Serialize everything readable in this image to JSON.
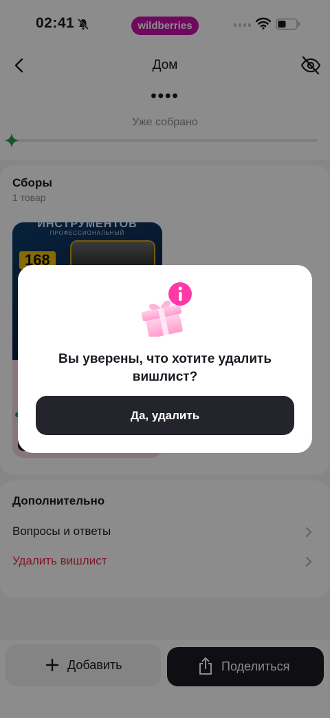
{
  "status_bar": {
    "time": "02:41",
    "brand": "wildberries",
    "brand_color": "#cb11ab"
  },
  "header": {
    "title": "Дом",
    "dots": "••••",
    "collected_label": "Уже собрано",
    "progress_fraction": 0
  },
  "collections": {
    "title": "Сборы",
    "count_label": "1 товар",
    "product": {
      "image_title": "ИНСТРУМЕНТОВ",
      "image_subtitle": "ПРОФЕССИОНАЛЬНЫЙ",
      "image_number": "168"
    }
  },
  "extra": {
    "title": "Дополнительно",
    "items": [
      {
        "label": "Вопросы и ответы"
      },
      {
        "label": "Удалить вишлист"
      }
    ]
  },
  "bottom_bar": {
    "add_label": "Добавить",
    "share_label": "Поделиться"
  },
  "dialog": {
    "icon": "gift-info-icon",
    "message": "Вы уверены, что хотите удалить вишлист?",
    "confirm_label": "Да, удалить"
  },
  "colors": {
    "danger": "#e8294a",
    "accent_green": "#1f9d55",
    "dark_button": "#24242c"
  }
}
